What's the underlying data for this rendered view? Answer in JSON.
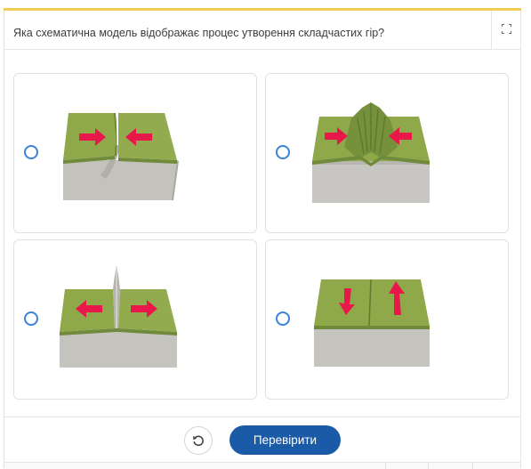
{
  "question": {
    "text": "Яка схематична модель відображає процес утворення складчастих гір?"
  },
  "toolbar": {
    "fullscreen_icon": "fullscreen-icon"
  },
  "options": [
    {
      "id": "a",
      "illustration": "plates-converging-subduction",
      "selected": false
    },
    {
      "id": "b",
      "illustration": "plates-converging-folded-mountains",
      "selected": false
    },
    {
      "id": "c",
      "illustration": "plates-diverging-rift",
      "selected": false
    },
    {
      "id": "d",
      "illustration": "transform-fault-sliding",
      "selected": false
    }
  ],
  "footer": {
    "reset_icon": "reset-icon",
    "check_label": "Перевірити"
  },
  "colors": {
    "accent_top": "#f2cd55",
    "primary_button": "#1a5aa6",
    "radio": "#3b82d6",
    "arrow": "#e8194a",
    "land": "#8fa84a",
    "rock": "#c8c6c2"
  }
}
